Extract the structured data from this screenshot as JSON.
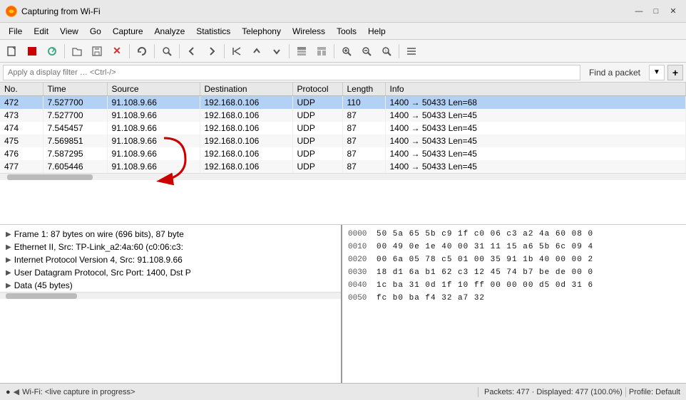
{
  "titleBar": {
    "title": "Capturing from Wi-Fi",
    "minimizeBtn": "—",
    "maximizeBtn": "□",
    "closeBtn": "✕"
  },
  "menuBar": {
    "items": [
      "File",
      "Edit",
      "View",
      "Go",
      "Capture",
      "Analyze",
      "Statistics",
      "Telephony",
      "Wireless",
      "Tools",
      "Help"
    ]
  },
  "toolbar": {
    "buttons": [
      {
        "id": "new",
        "icon": "📄"
      },
      {
        "id": "stop",
        "icon": "⏹"
      },
      {
        "id": "restart",
        "icon": "🔄"
      },
      {
        "id": "open",
        "icon": "📁"
      },
      {
        "id": "save",
        "icon": "💾"
      },
      {
        "id": "close",
        "icon": "✕"
      },
      {
        "id": "reload",
        "icon": "↺"
      },
      {
        "id": "find",
        "icon": "🔍"
      },
      {
        "id": "back",
        "icon": "◀"
      },
      {
        "id": "fwd",
        "icon": "▶"
      },
      {
        "id": "jump1",
        "icon": "⏭"
      },
      {
        "id": "jump2",
        "icon": "⬆"
      },
      {
        "id": "jump3",
        "icon": "⬇"
      },
      {
        "id": "pane1",
        "icon": "▤"
      },
      {
        "id": "pane2",
        "icon": "▦"
      },
      {
        "id": "zoomin",
        "icon": "🔍"
      },
      {
        "id": "zoomout",
        "icon": "🔍"
      },
      {
        "id": "zoomreset",
        "icon": "🔍"
      },
      {
        "id": "more",
        "icon": "⋮"
      }
    ]
  },
  "filterBar": {
    "placeholder": "Apply a display filter … <Ctrl-/>",
    "findPacketLabel": "Find a packet",
    "arrowBtnLabel": "▼"
  },
  "packetList": {
    "columns": [
      "No.",
      "Time",
      "Source",
      "Destination",
      "Protocol",
      "Length",
      "Info"
    ],
    "rows": [
      {
        "no": "472",
        "time": "7.527700",
        "source": "91.108.9.66",
        "destination": "192.168.0.106",
        "protocol": "UDP",
        "length": "110",
        "info": "1400 → 50433 Len=68",
        "selected": true
      },
      {
        "no": "473",
        "time": "7.527700",
        "source": "91.108.9.66",
        "destination": "192.168.0.106",
        "protocol": "UDP",
        "length": "87",
        "info": "1400 → 50433 Len=45",
        "selected": false
      },
      {
        "no": "474",
        "time": "7.545457",
        "source": "91.108.9.66",
        "destination": "192.168.0.106",
        "protocol": "UDP",
        "length": "87",
        "info": "1400 → 50433 Len=45",
        "selected": false
      },
      {
        "no": "475",
        "time": "7.569851",
        "source": "91.108.9.66",
        "destination": "192.168.0.106",
        "protocol": "UDP",
        "length": "87",
        "info": "1400 → 50433 Len=45",
        "selected": false
      },
      {
        "no": "476",
        "time": "7.587295",
        "source": "91.108.9.66",
        "destination": "192.168.0.106",
        "protocol": "UDP",
        "length": "87",
        "info": "1400 → 50433 Len=45",
        "selected": false
      },
      {
        "no": "477",
        "time": "7.605446",
        "source": "91.108.9.66",
        "destination": "192.168.0.106",
        "protocol": "UDP",
        "length": "87",
        "info": "1400 → 50433 Len=45",
        "selected": false
      }
    ]
  },
  "packetDetails": {
    "items": [
      {
        "text": "Frame 1: 87 bytes on wire (696 bits), 87 byte"
      },
      {
        "text": "Ethernet II, Src: TP-Link_a2:4a:60 (c0:06:c3:"
      },
      {
        "text": "Internet Protocol Version 4, Src: 91.108.9.66"
      },
      {
        "text": "User Datagram Protocol, Src Port: 1400, Dst P"
      },
      {
        "text": "Data (45 bytes)"
      }
    ]
  },
  "hexPanel": {
    "rows": [
      {
        "offset": "0000",
        "bytes": "50 5a 65 5b c9 1f c0 06   c3 a2 4a 60 08 0"
      },
      {
        "offset": "0010",
        "bytes": "00 49 0e 1e 40 00 31 11   15 a6 5b 6c 09 4"
      },
      {
        "offset": "0020",
        "bytes": "00 6a 05 78 c5 01 00 35   91 1b 40 00 00 2"
      },
      {
        "offset": "0030",
        "bytes": "18 d1 6a b1 62 c3 12 45   74 b7 be de 00 0"
      },
      {
        "offset": "0040",
        "bytes": "1c ba 31 0d 1f 10 ff 00   00 00 d5 0d 31 6"
      },
      {
        "offset": "0050",
        "bytes": "fc b0 ba f4 32 a7 32"
      }
    ]
  },
  "statusBar": {
    "profileIcon": "●",
    "liveIcon": "◀",
    "captureStatus": "Wi-Fi: <live capture in progress>",
    "packetsInfo": "Packets: 477 · Displayed: 477 (100.0%)",
    "profileInfo": "Profile: Default"
  },
  "colors": {
    "selectedRow": "#b3d1f5",
    "headerBg": "#e8e8e8",
    "arrowRed": "#cc0000"
  }
}
